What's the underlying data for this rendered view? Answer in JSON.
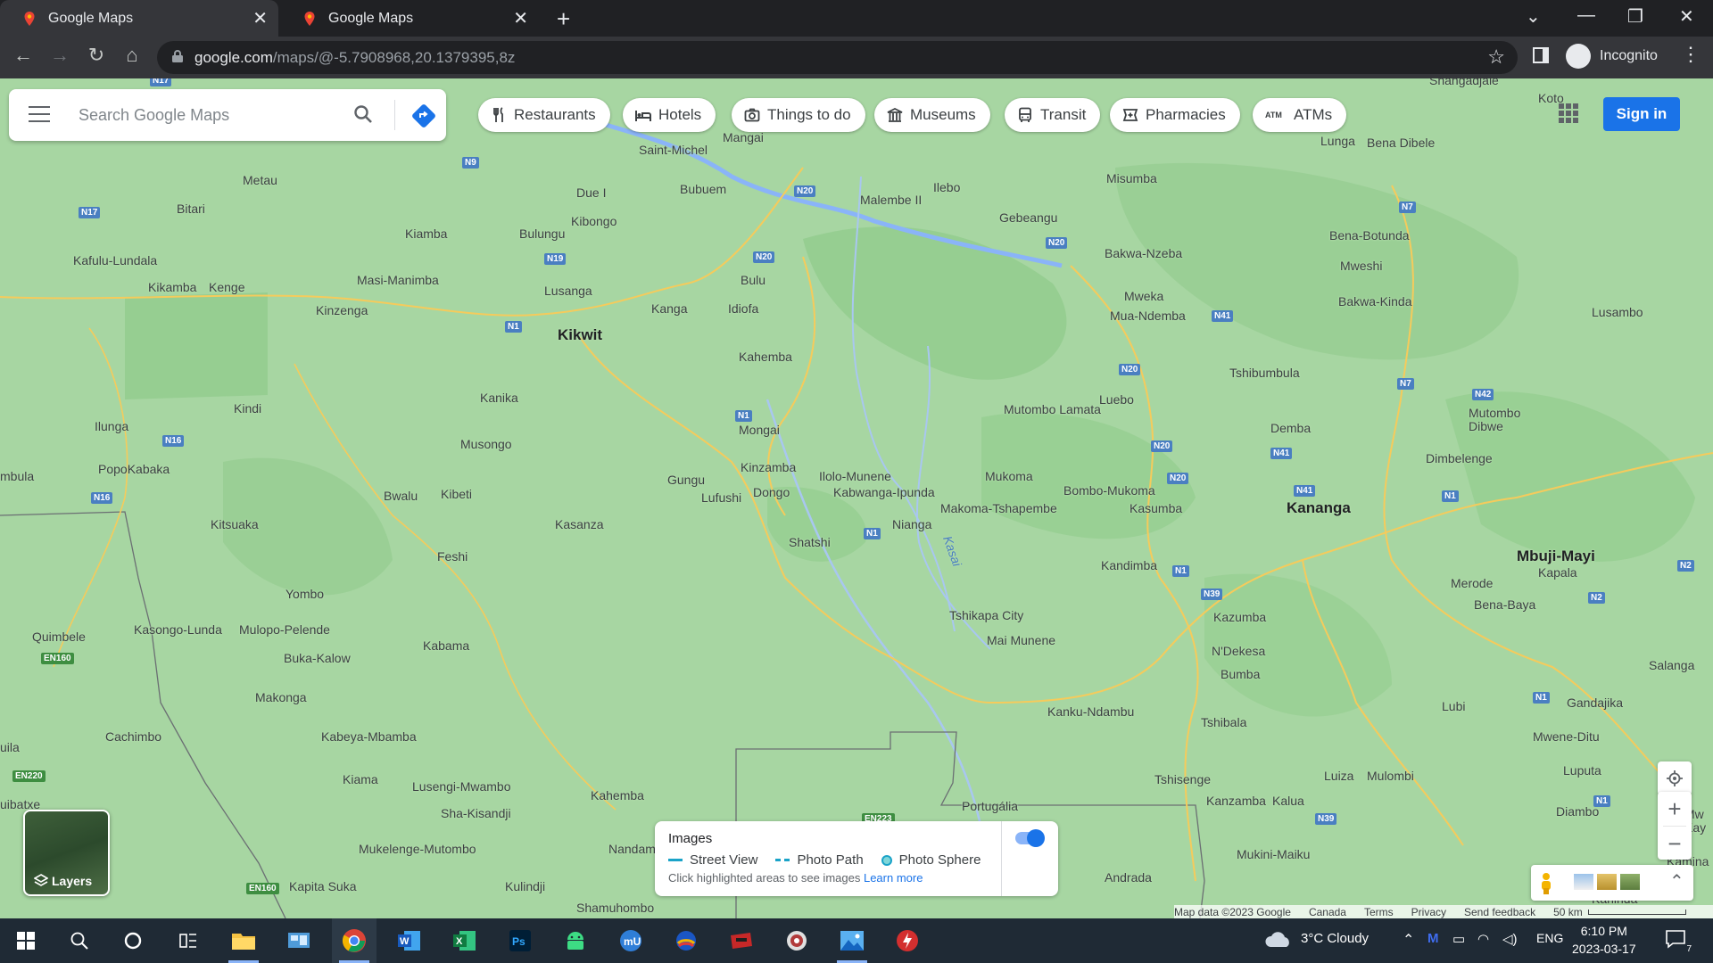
{
  "browser": {
    "tabs": [
      {
        "title": "Google Maps",
        "active": true
      },
      {
        "title": "Google Maps",
        "active": false
      }
    ],
    "url_host": "google.com",
    "url_path": "/maps/@-5.7908968,20.1379395,8z",
    "profile_label": "Incognito"
  },
  "maps": {
    "search_placeholder": "Search Google Maps",
    "chips": [
      {
        "label": "Restaurants",
        "icon": "fork-knife-icon"
      },
      {
        "label": "Hotels",
        "icon": "bed-icon"
      },
      {
        "label": "Things to do",
        "icon": "camera-icon"
      },
      {
        "label": "Museums",
        "icon": "museum-icon"
      },
      {
        "label": "Transit",
        "icon": "bus-icon"
      },
      {
        "label": "Pharmacies",
        "icon": "pharmacy-icon"
      },
      {
        "label": "ATMs",
        "icon": "atm-icon"
      }
    ],
    "sign_in": "Sign in",
    "layers_label": "Layers",
    "images_panel": {
      "title": "Images",
      "legend": [
        "Street View",
        "Photo Path",
        "Photo Sphere"
      ],
      "hint": "Click highlighted areas to see images",
      "learn_more": "Learn more",
      "toggle_on": true
    },
    "attribution": {
      "map_data": "Map data ©2023 Google",
      "country": "Canada",
      "terms": "Terms",
      "privacy": "Privacy",
      "feedback": "Send feedback",
      "scale": "50 km"
    },
    "places": [
      {
        "name": "Shangadjale"
      },
      {
        "name": "Koto"
      },
      {
        "name": "Mangai"
      },
      {
        "name": "Saint-Michel"
      },
      {
        "name": "Lunga"
      },
      {
        "name": "Bena Dibele"
      },
      {
        "name": "Metau"
      },
      {
        "name": "Due I"
      },
      {
        "name": "Bubuem"
      },
      {
        "name": "Malembe II"
      },
      {
        "name": "Ilebo"
      },
      {
        "name": "Misumba"
      },
      {
        "name": "Bitari"
      },
      {
        "name": "Kibongo"
      },
      {
        "name": "Gebeangu"
      },
      {
        "name": "Kiamba"
      },
      {
        "name": "Bulungu"
      },
      {
        "name": "Bena-Botunda"
      },
      {
        "name": "Kafulu-Lundala"
      },
      {
        "name": "Bakwa-Nzeba"
      },
      {
        "name": "Mweshi"
      },
      {
        "name": "Bulu"
      },
      {
        "name": "Masi-Manimba"
      },
      {
        "name": "Kikamba"
      },
      {
        "name": "Kenge"
      },
      {
        "name": "Lusanga"
      },
      {
        "name": "Mweka"
      },
      {
        "name": "Bakwa-Kinda"
      },
      {
        "name": "Kinzenga"
      },
      {
        "name": "Kanga"
      },
      {
        "name": "Idiofa"
      },
      {
        "name": "Mua-Ndemba"
      },
      {
        "name": "Lusambo"
      },
      {
        "name": "Kikwit",
        "major": true
      },
      {
        "name": "Kahemba"
      },
      {
        "name": "Tshibumbula"
      },
      {
        "name": "Kanika"
      },
      {
        "name": "Luebo"
      },
      {
        "name": "Mutombo Lamata"
      },
      {
        "name": "Mutombo Dibwe"
      },
      {
        "name": "Kindi"
      },
      {
        "name": "Mongai"
      },
      {
        "name": "Demba"
      },
      {
        "name": "Ilunga"
      },
      {
        "name": "Musongo"
      },
      {
        "name": "Dimbelenge"
      },
      {
        "name": "PopoKabaka"
      },
      {
        "name": "Kinzamba"
      },
      {
        "name": "Ilolo-Munene"
      },
      {
        "name": "Mukoma"
      },
      {
        "name": "mbula"
      },
      {
        "name": "Gungu"
      },
      {
        "name": "Bombo-Mukoma"
      },
      {
        "name": "Bwalu"
      },
      {
        "name": "Kibeti"
      },
      {
        "name": "Lufushi"
      },
      {
        "name": "Dongo"
      },
      {
        "name": "Kabwanga-Ipunda"
      },
      {
        "name": "Makoma-Tshapembe"
      },
      {
        "name": "Kasumba"
      },
      {
        "name": "Kananga",
        "major": true
      },
      {
        "name": "Kitsuaka"
      },
      {
        "name": "Kasanza"
      },
      {
        "name": "Nianga"
      },
      {
        "name": "Shatshi"
      },
      {
        "name": "Feshi"
      },
      {
        "name": "Mbuji-Mayi",
        "major": true
      },
      {
        "name": "Kandimba"
      },
      {
        "name": "Kapala"
      },
      {
        "name": "Merode"
      },
      {
        "name": "Yombo"
      },
      {
        "name": "Bena-Baya"
      },
      {
        "name": "Quimbele"
      },
      {
        "name": "Kasongo-Lunda"
      },
      {
        "name": "Mulopo-Pelende"
      },
      {
        "name": "Tshikapa City"
      },
      {
        "name": "Kazumba"
      },
      {
        "name": "Mai Munene"
      },
      {
        "name": "Kabama"
      },
      {
        "name": "Buka-Kalow"
      },
      {
        "name": "N'Dekesa"
      },
      {
        "name": "Salanga"
      },
      {
        "name": "Bumba"
      },
      {
        "name": "Makonga"
      },
      {
        "name": "Gandajika"
      },
      {
        "name": "Lubi"
      },
      {
        "name": "Kanku-Ndambu"
      },
      {
        "name": "Tshibala"
      },
      {
        "name": "Cachimbo"
      },
      {
        "name": "Kabeya-Mbamba"
      },
      {
        "name": "Mwene-Ditu"
      },
      {
        "name": "uila"
      },
      {
        "name": "Kiama"
      },
      {
        "name": "Lusengi-Mwambo"
      },
      {
        "name": "Tshisenge"
      },
      {
        "name": "Luiza"
      },
      {
        "name": "Mulombi"
      },
      {
        "name": "Luputa"
      },
      {
        "name": "uibatxe"
      },
      {
        "name": "Kahemba"
      },
      {
        "name": "Sha-Kisandji"
      },
      {
        "name": "Portugália"
      },
      {
        "name": "Kanzamba"
      },
      {
        "name": "Kalua"
      },
      {
        "name": "Diambo"
      },
      {
        "name": "Mukelenge-Mutombo"
      },
      {
        "name": "Nandam"
      },
      {
        "name": "Mukini-Maiku"
      },
      {
        "name": "Kapita Suka"
      },
      {
        "name": "Kulindji"
      },
      {
        "name": "Andrada"
      },
      {
        "name": "Kamina"
      },
      {
        "name": "Shamuhombo"
      },
      {
        "name": "Kahinda"
      },
      {
        "name": "Mw Kay"
      }
    ],
    "road_shields": [
      "N17",
      "N9",
      "N20",
      "N20",
      "N17",
      "N19",
      "N20",
      "N20",
      "N7",
      "N1",
      "N41",
      "N20",
      "N7",
      "N42",
      "N1",
      "N16",
      "N41",
      "N16",
      "N20",
      "N41",
      "N1",
      "N1",
      "N1",
      "N39",
      "N2",
      "N2",
      "EN160",
      "N1",
      "EN220",
      "N39",
      "EN223",
      "N1",
      "EN160"
    ],
    "river_label": "Kasai"
  },
  "taskbar": {
    "apps": [
      {
        "name": "start",
        "icon": "windows-icon"
      },
      {
        "name": "search",
        "icon": "search-icon"
      },
      {
        "name": "cortana",
        "icon": "cortana-icon"
      },
      {
        "name": "task-view",
        "icon": "task-view-icon"
      },
      {
        "name": "file-explorer",
        "icon": "folder-icon"
      },
      {
        "name": "control-panel",
        "icon": "control-panel-icon"
      },
      {
        "name": "chrome",
        "icon": "chrome-icon"
      },
      {
        "name": "word",
        "icon": "word-icon"
      },
      {
        "name": "excel",
        "icon": "excel-icon"
      },
      {
        "name": "photoshop",
        "icon": "photoshop-icon"
      },
      {
        "name": "android",
        "icon": "android-icon"
      },
      {
        "name": "mu",
        "icon": "mu-icon"
      },
      {
        "name": "app-12",
        "icon": "circle-app-icon"
      },
      {
        "name": "app-13",
        "icon": "red-app-icon"
      },
      {
        "name": "app-14",
        "icon": "target-app-icon"
      },
      {
        "name": "photos",
        "icon": "photos-icon"
      },
      {
        "name": "app-16",
        "icon": "flash-app-icon"
      }
    ],
    "weather": "3°C  Cloudy",
    "lang": "ENG",
    "time": "6:10 PM",
    "date": "2023-03-17",
    "notifications": "7"
  }
}
